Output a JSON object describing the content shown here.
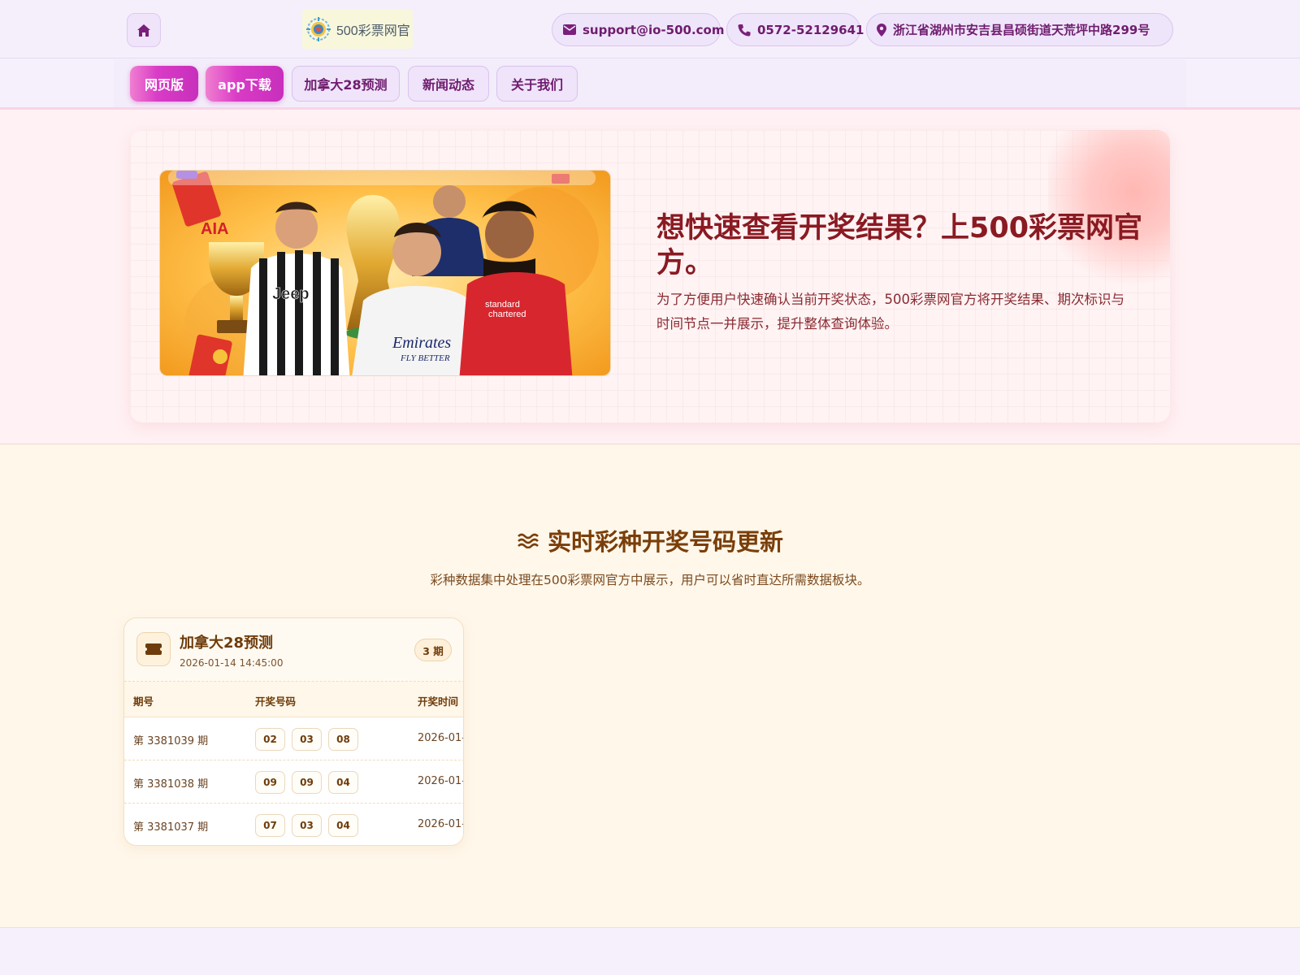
{
  "header": {
    "home_icon": "home-icon",
    "logo_text": "500彩票网官",
    "email": "support@io-500.com",
    "phone": "0572-52129641",
    "address": "浙江省湖州市安吉县昌硕街道天荒坪中路299号"
  },
  "nav": {
    "items": [
      {
        "label": "网页版",
        "active": true
      },
      {
        "label": "app下载",
        "active": true
      },
      {
        "label": "加拿大28预测",
        "active": false
      },
      {
        "label": "新闻动态",
        "active": false
      },
      {
        "label": "关于我们",
        "active": false
      }
    ]
  },
  "hero": {
    "title": "想快速查看开奖结果？上500彩票网官方。",
    "description": "为了方便用户快速确认当前开奖状态，500彩票网官方将开奖结果、期次标识与时间节点一并展示，提升整体查询体验。"
  },
  "live": {
    "title": "实时彩种开奖号码更新",
    "subtitle": "彩种数据集中处理在500彩票网官方中展示，用户可以省时直达所需数据板块。",
    "card": {
      "name": "加拿大28预测",
      "time": "2026-01-14 14:45:00",
      "badge": "3 期",
      "headers": [
        "期号",
        "开奖号码",
        "开奖时间"
      ],
      "rows": [
        {
          "issue": "第 3381039 期",
          "balls": [
            "02",
            "03",
            "08"
          ],
          "time": "2026-01-"
        },
        {
          "issue": "第 3381038 期",
          "balls": [
            "09",
            "09",
            "04"
          ],
          "time": "2026-01-"
        },
        {
          "issue": "第 3381037 期",
          "balls": [
            "07",
            "03",
            "04"
          ],
          "time": "2026-01-"
        }
      ]
    }
  },
  "colors": {
    "accent": "#d93cc6",
    "brand_text": "#6f1c6e",
    "hero_title": "#8a1a22",
    "section_title": "#7a3e09"
  }
}
